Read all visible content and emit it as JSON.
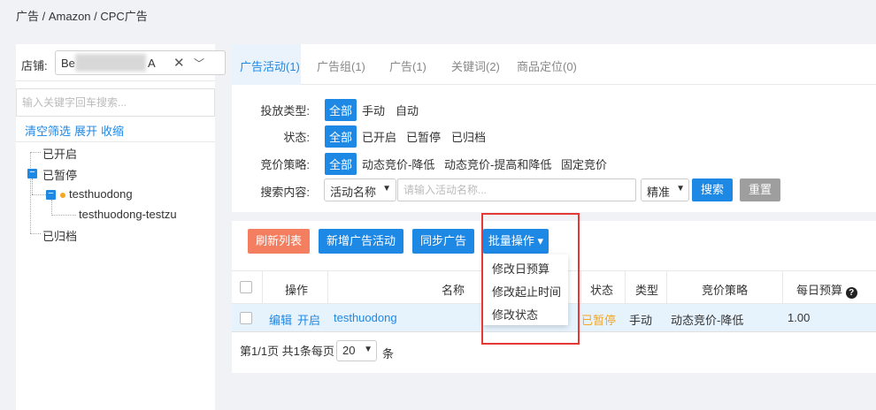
{
  "breadcrumb": "广告 / Amazon / CPC广告",
  "store": {
    "label": "店铺:",
    "value_prefix": "Be",
    "value_suffix": "A",
    "clear_icon": "close-icon",
    "chevron_icon": "chevron-down-icon"
  },
  "tree_search": {
    "placeholder": "输入关键字回车搜索..."
  },
  "tree_links": {
    "clear": "清空筛选",
    "expand": "展开",
    "collapse": "收缩"
  },
  "tree": {
    "enabled": "已开启",
    "paused": "已暂停",
    "campaign": "testhuodong",
    "group": "testhuodong-testzu",
    "archived": "已归档"
  },
  "tabs": [
    "广告活动(1)",
    "广告组(1)",
    "广告(1)",
    "关键词(2)",
    "商品定位(0)"
  ],
  "filters": {
    "type_label": "投放类型:",
    "type_options": [
      "全部",
      "手动",
      "自动"
    ],
    "status_label": "状态:",
    "status_options": [
      "全部",
      "已开启",
      "已暂停",
      "已归档"
    ],
    "bid_label": "竞价策略:",
    "bid_options": [
      "全部",
      "动态竞价-降低",
      "动态竞价-提高和降低",
      "固定竞价"
    ],
    "search_label": "搜索内容:",
    "search_field": "活动名称",
    "search_placeholder": "请输入活动名称...",
    "match_mode": "精准",
    "search_button": "搜索",
    "reset_button": "重置"
  },
  "actions": {
    "refresh": "刷新列表",
    "add": "新增广告活动",
    "sync": "同步广告",
    "batch": "批量操作 ▾"
  },
  "batch_menu": [
    "修改日预算",
    "修改起止时间",
    "修改状态"
  ],
  "table": {
    "headers": [
      "操作",
      "名称",
      "状态",
      "类型",
      "竞价策略",
      "每日预算"
    ],
    "rows": [
      {
        "edit": "编辑",
        "enable": "开启",
        "name": "testhuodong",
        "status": "已暂停",
        "type": "手动",
        "bid": "动态竞价-降低",
        "budget": "1.00"
      }
    ]
  },
  "pager": {
    "text": "第1/1页 共1条每页",
    "page_size": "20",
    "unit": "条"
  },
  "colors": {
    "primary": "#1e88e5",
    "refresh": "#f47e60",
    "paused": "#f5a623",
    "reset": "#9e9e9e",
    "highlight": "#e53935"
  }
}
